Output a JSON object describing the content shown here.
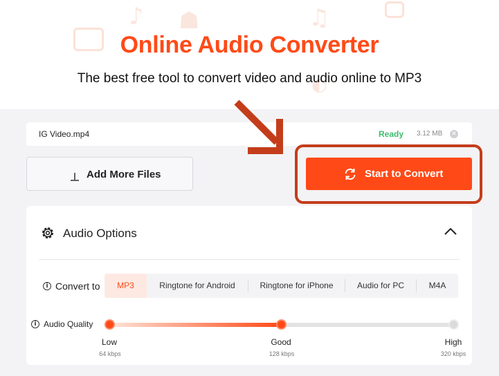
{
  "hero": {
    "title": "Online Audio Converter",
    "subtitle": "The best free tool to convert video and audio online to MP3"
  },
  "file": {
    "name": "IG Video.mp4",
    "status": "Ready",
    "size": "3.12 MB",
    "remove_icon": "close-icon"
  },
  "actions": {
    "add_files_label": "Add More Files",
    "convert_label": "Start to Convert",
    "add_icon": "upload-icon",
    "convert_icon": "refresh-icon"
  },
  "options": {
    "title": "Audio Options",
    "convert_to_label": "Convert to",
    "formats": [
      "MP3",
      "Ringtone for Android",
      "Ringtone for iPhone",
      "Audio for PC",
      "M4A"
    ],
    "selected_format": "MP3",
    "quality_label": "Audio Quality",
    "quality_levels": [
      {
        "name": "Low",
        "bitrate": "64 kbps"
      },
      {
        "name": "Good",
        "bitrate": "128 kbps"
      },
      {
        "name": "High",
        "bitrate": "320 kbps"
      }
    ],
    "selected_quality": "Good"
  },
  "colors": {
    "accent": "#ff4a17",
    "ready": "#3dbb6e",
    "highlight_outline": "#c43d1b"
  }
}
